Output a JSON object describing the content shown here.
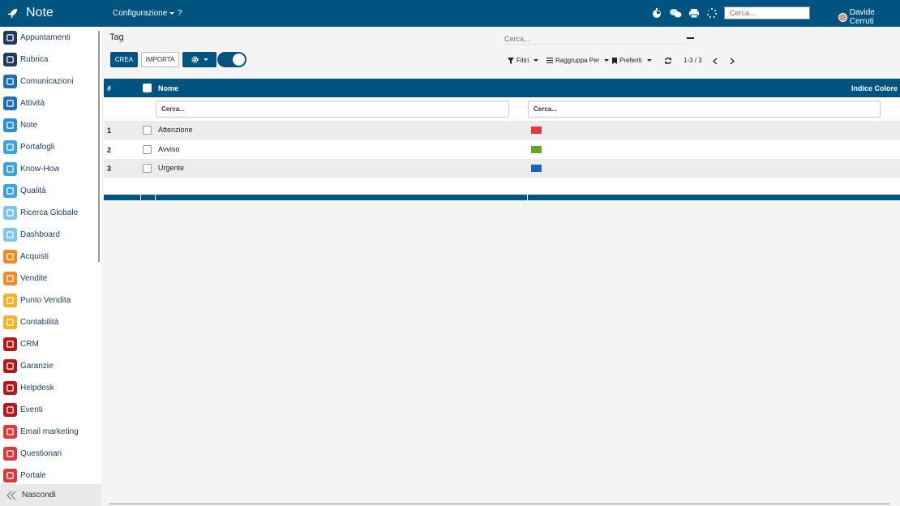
{
  "app": {
    "title": "Note"
  },
  "topbar": {
    "menu_config": "Configurazione",
    "menu_help": "?",
    "search_placeholder": "Cerca...",
    "user_name": "Davide Cerruti"
  },
  "sidebar": {
    "items": [
      {
        "label": "Appuntamenti",
        "icon": "calendar-icon",
        "color": "#1f3a5c"
      },
      {
        "label": "Rubrica",
        "icon": "contacts-icon",
        "color": "#1f3a5c"
      },
      {
        "label": "Comunicazioni",
        "icon": "chat-icon",
        "color": "#1b6fb5"
      },
      {
        "label": "Attività",
        "icon": "checkmark-icon",
        "color": "#1b6fb5"
      },
      {
        "label": "Note",
        "icon": "note-icon",
        "color": "#2a8fd8"
      },
      {
        "label": "Portafogli",
        "icon": "lock-icon",
        "color": "#3aa3e0"
      },
      {
        "label": "Know-How",
        "icon": "brain-icon",
        "color": "#3aa3e0"
      },
      {
        "label": "Qualità",
        "icon": "clock-icon",
        "color": "#3aa3e0"
      },
      {
        "label": "Ricerca Globale",
        "icon": "globe-icon",
        "color": "#7cc6ec"
      },
      {
        "label": "Dashboard",
        "icon": "dashboard-icon",
        "color": "#7cc6ec"
      },
      {
        "label": "Acquisti",
        "icon": "cart-icon",
        "color": "#f08a24"
      },
      {
        "label": "Vendite",
        "icon": "chart-line-icon",
        "color": "#f08a24"
      },
      {
        "label": "Punto Vendita",
        "icon": "store-icon",
        "color": "#f5b325"
      },
      {
        "label": "Contabilità",
        "icon": "ledger-icon",
        "color": "#f5b325"
      },
      {
        "label": "CRM",
        "icon": "handshake-icon",
        "color": "#b31b1b"
      },
      {
        "label": "Garanzie",
        "icon": "shield-icon",
        "color": "#b31b1b"
      },
      {
        "label": "Helpdesk",
        "icon": "headset-icon",
        "color": "#b31b1b"
      },
      {
        "label": "Eventi",
        "icon": "ticket-icon",
        "color": "#b31b1b"
      },
      {
        "label": "Email marketing",
        "icon": "paper-plane-icon",
        "color": "#e0383a"
      },
      {
        "label": "Questionari",
        "icon": "clipboard-icon",
        "color": "#e0383a"
      },
      {
        "label": "Portale",
        "icon": "heart-icon",
        "color": "#e0383a"
      }
    ],
    "hide_label": "Nascondi"
  },
  "main": {
    "title": "Tag",
    "search_placeholder": "Cerca...",
    "buttons": {
      "create": "CREA",
      "import": "IMPORTA"
    },
    "controls": {
      "filters": "Filtri",
      "group_by": "Raggruppa Per",
      "favorites": "Preferiti",
      "pager": "1-3 / 3"
    },
    "table": {
      "headers": {
        "number": "#",
        "name": "Nome",
        "color": "Indice Colore"
      },
      "filter_placeholder": "Cerca...",
      "rows": [
        {
          "num": "1",
          "name": "Attenzione",
          "color": "#e03a3a"
        },
        {
          "num": "2",
          "name": "Avviso",
          "color": "#6aa61f"
        },
        {
          "num": "3",
          "name": "Urgente",
          "color": "#1566c0"
        }
      ]
    }
  }
}
